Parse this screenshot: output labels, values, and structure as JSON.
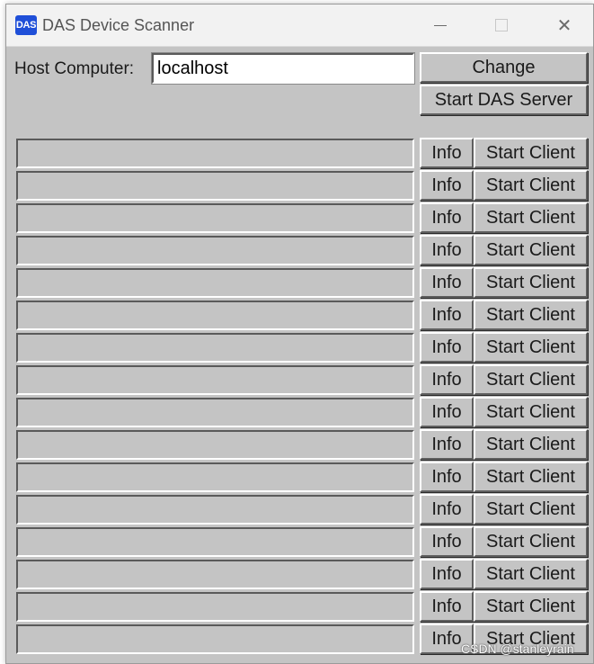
{
  "window": {
    "title": "DAS Device Scanner",
    "icon_text": "DAS",
    "icon_color": "#1f4fd8"
  },
  "host": {
    "label": "Host Computer:",
    "value": "localhost"
  },
  "buttons": {
    "change": "Change",
    "start_server": "Start DAS Server"
  },
  "devices": [
    {
      "name": "",
      "info": "Info",
      "start": "Start Client"
    },
    {
      "name": "",
      "info": "Info",
      "start": "Start Client"
    },
    {
      "name": "",
      "info": "Info",
      "start": "Start Client"
    },
    {
      "name": "",
      "info": "Info",
      "start": "Start Client"
    },
    {
      "name": "",
      "info": "Info",
      "start": "Start Client"
    },
    {
      "name": "",
      "info": "Info",
      "start": "Start Client"
    },
    {
      "name": "",
      "info": "Info",
      "start": "Start Client"
    },
    {
      "name": "",
      "info": "Info",
      "start": "Start Client"
    },
    {
      "name": "",
      "info": "Info",
      "start": "Start Client"
    },
    {
      "name": "",
      "info": "Info",
      "start": "Start Client"
    },
    {
      "name": "",
      "info": "Info",
      "start": "Start Client"
    },
    {
      "name": "",
      "info": "Info",
      "start": "Start Client"
    },
    {
      "name": "",
      "info": "Info",
      "start": "Start Client"
    },
    {
      "name": "",
      "info": "Info",
      "start": "Start Client"
    },
    {
      "name": "",
      "info": "Info",
      "start": "Start Client"
    },
    {
      "name": "",
      "info": "Info",
      "start": "Start Client"
    }
  ],
  "watermark": "CSDN @stanleyrain"
}
